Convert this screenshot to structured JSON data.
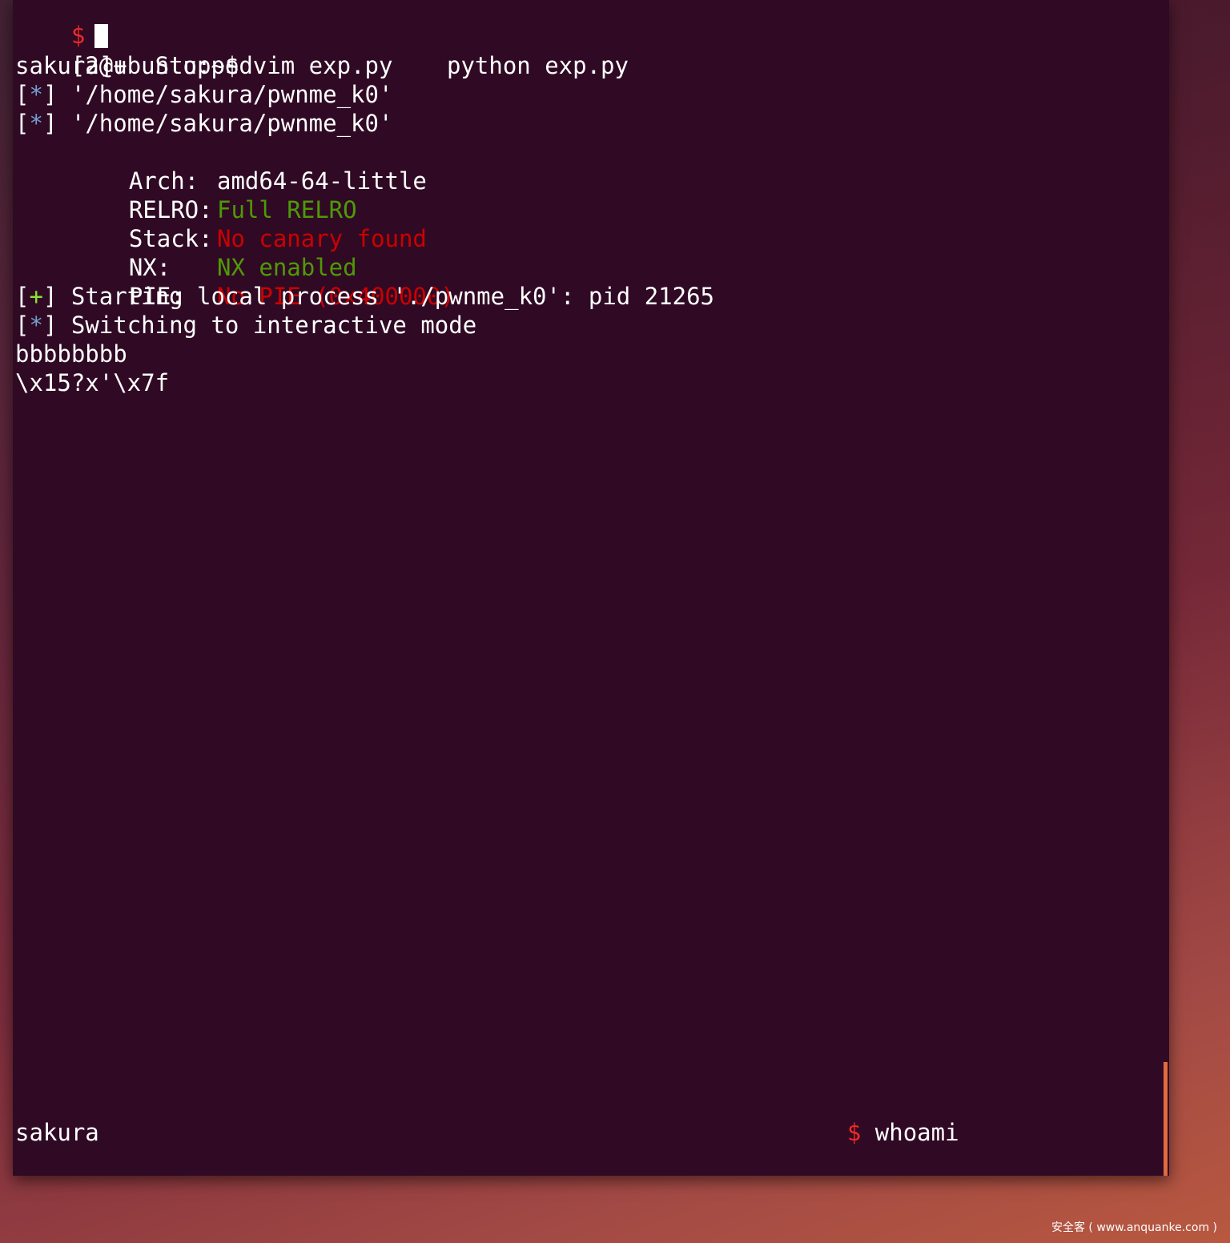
{
  "terminal": {
    "top_prompt": "$",
    "job_line": {
      "jobs": "[2]+  Stopped",
      "command": "python exp.py"
    },
    "shell_prompt": "sakura@ubuntu:~$ vim exp.py",
    "info_lines": [
      {
        "marker": "*",
        "text": "'/home/sakura/pwnme_k0'"
      },
      {
        "marker": "*",
        "text": "'/home/sakura/pwnme_k0'"
      }
    ],
    "checksec": [
      {
        "label": "Arch:",
        "value": "amd64-64-little",
        "status": "normal"
      },
      {
        "label": "RELRO:",
        "value": "Full RELRO",
        "status": "good"
      },
      {
        "label": "Stack:",
        "value": "No canary found",
        "status": "bad"
      },
      {
        "label": "NX:",
        "value": "NX enabled",
        "status": "good"
      },
      {
        "label": "PIE:",
        "value": "No PIE (0x400000)",
        "status": "bad"
      }
    ],
    "process_line": {
      "marker": "+",
      "text": "Starting local process './pwnme_k0': pid 21265"
    },
    "interactive_line": {
      "marker": "*",
      "text": "Switching to interactive mode"
    },
    "output_1": "bbbbbbbb",
    "output_2": "\\x15?x'\\x7f",
    "whoami_prompt": "$",
    "whoami_command": "whoami",
    "whoami_output": "sakura",
    "bottom_prompt": "$"
  },
  "colors": {
    "background": "#300a24",
    "info_marker": "#729fcf",
    "good": "#4e9a06",
    "bad": "#cc0000",
    "plus_marker": "#8ae234",
    "prompt_dollar": "#ef2929"
  },
  "watermark": "安全客 ( www.anquanke.com )"
}
